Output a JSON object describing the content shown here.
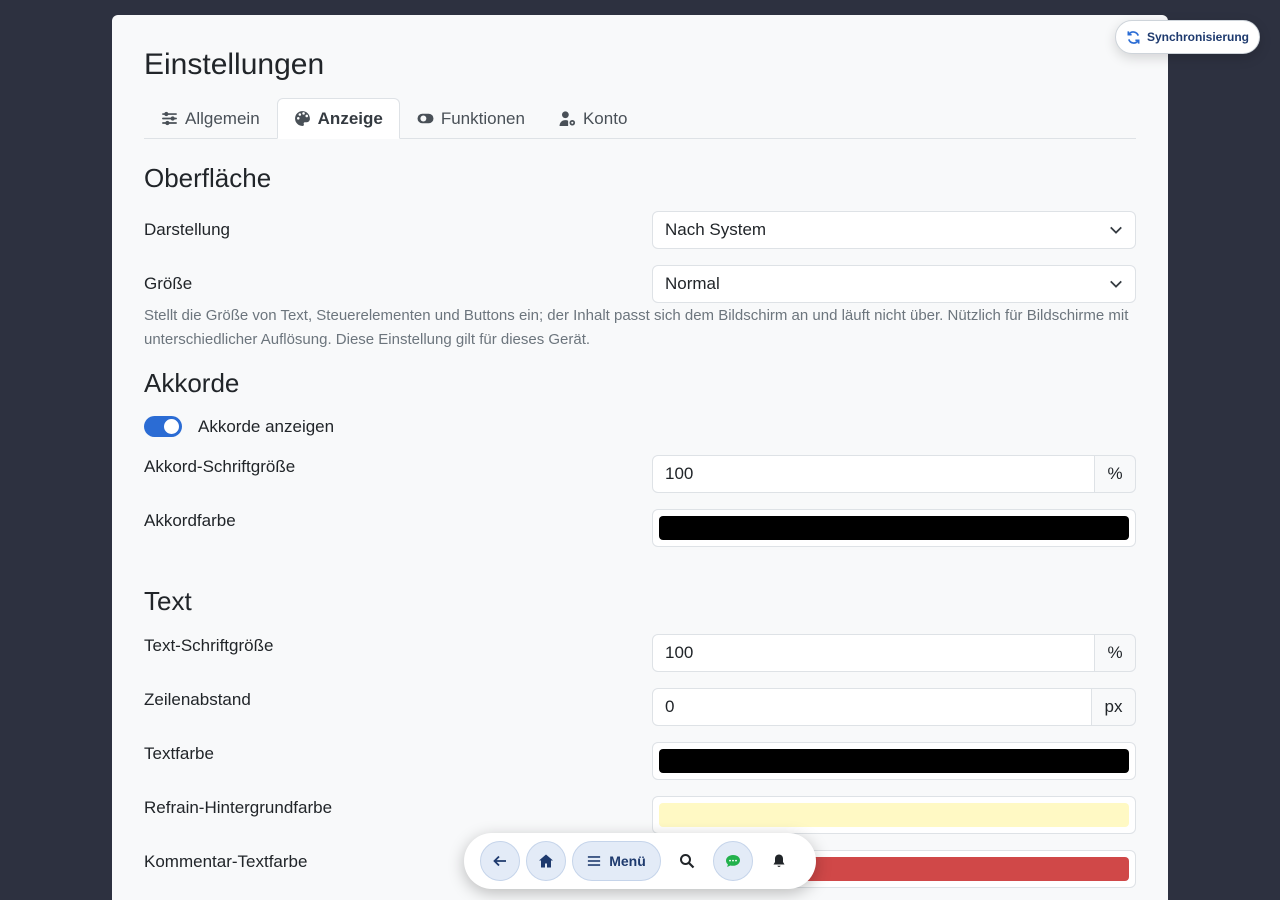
{
  "page": {
    "title": "Einstellungen"
  },
  "tabs": [
    {
      "label": "Allgemein",
      "icon": "sliders-icon",
      "active": false
    },
    {
      "label": "Anzeige",
      "icon": "palette-icon",
      "active": true
    },
    {
      "label": "Funktionen",
      "icon": "toggle-icon",
      "active": false
    },
    {
      "label": "Konto",
      "icon": "user-cog-icon",
      "active": false
    }
  ],
  "sections": {
    "surface": {
      "title": "Oberfläche",
      "appearance": {
        "label": "Darstellung",
        "value": "Nach System"
      },
      "size": {
        "label": "Größe",
        "value": "Normal",
        "help": "Stellt die Größe von Text, Steuerelementen und Buttons ein; der Inhalt passt sich dem Bildschirm an und läuft nicht über. Nützlich für Bildschirme mit unterschiedlicher Auflösung. Diese Einstellung gilt für dieses Gerät."
      }
    },
    "chords": {
      "title": "Akkorde",
      "show": {
        "label": "Akkorde anzeigen",
        "checked": true
      },
      "font_size": {
        "label": "Akkord-Schriftgröße",
        "value": "100",
        "unit": "%"
      },
      "color": {
        "label": "Akkordfarbe",
        "value": "#000000"
      }
    },
    "text": {
      "title": "Text",
      "font_size": {
        "label": "Text-Schriftgröße",
        "value": "100",
        "unit": "%"
      },
      "line_spacing": {
        "label": "Zeilenabstand",
        "value": "0",
        "unit": "px"
      },
      "text_color": {
        "label": "Textfarbe",
        "value": "#000000"
      },
      "refrain_bg": {
        "label": "Refrain-Hintergrundfarbe",
        "value": "#fff9c4"
      },
      "comment_color": {
        "label": "Kommentar-Textfarbe",
        "value": "#d04848"
      }
    }
  },
  "sync": {
    "label": "Synchronisierung",
    "icon": "sync-icon"
  },
  "bottom_bar": {
    "back": "arrow-left-icon",
    "home": "home-icon",
    "menu_label": "Menü",
    "search": "search-icon",
    "chat": "chat-icon",
    "notifications": "bell-icon"
  },
  "colors": {
    "accent": "#2b6cd4",
    "background": "#2d3140",
    "card": "#f8f9fa"
  }
}
